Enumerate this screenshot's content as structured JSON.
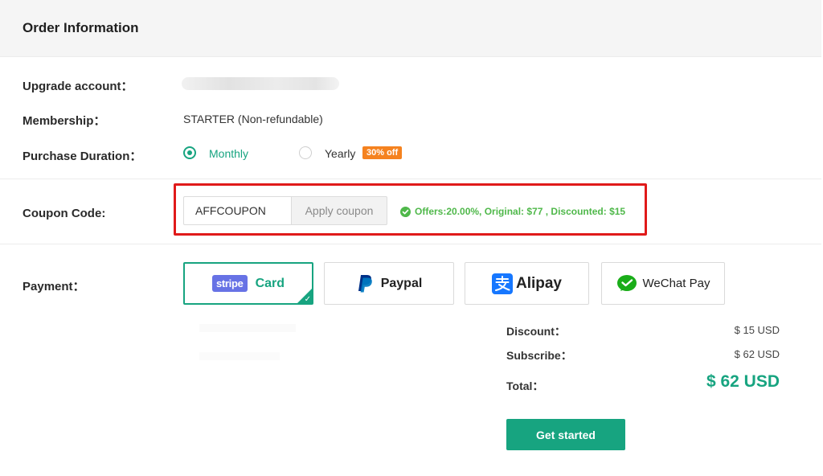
{
  "header": {
    "title": "Order Information"
  },
  "form": {
    "upgrade_account_label": "Upgrade account：",
    "membership_label": "Membership：",
    "membership_value": "STARTER (Non-refundable)",
    "duration_label": "Purchase Duration：",
    "duration_options": [
      {
        "label": "Monthly",
        "checked": true
      },
      {
        "label": "Yearly",
        "checked": false
      }
    ],
    "yearly_badge": "30% off",
    "coupon_label": "Coupon Code:",
    "coupon_value": "AFFCOUPON",
    "apply_label": "Apply coupon",
    "offer_text": "Offers:20.00%, Original: $77 , Discounted: $15",
    "payment_label": "Payment："
  },
  "payment_methods": [
    {
      "name": "stripe",
      "logo_text": "stripe",
      "label": "Card",
      "selected": true
    },
    {
      "name": "paypal",
      "label": "Paypal",
      "selected": false
    },
    {
      "name": "alipay",
      "label": "Alipay",
      "selected": false
    },
    {
      "name": "wechat",
      "label": "WeChat Pay",
      "selected": false
    }
  ],
  "summary": {
    "discount_label": "Discount：",
    "discount_value": "$ 15 USD",
    "subscribe_label": "Subscribe：",
    "subscribe_value": "$ 62 USD",
    "total_label": "Total：",
    "total_value": "$ 62 USD"
  },
  "cta": {
    "label": "Get started"
  },
  "colors": {
    "accent": "#17a480",
    "highlight": "#e01a1a",
    "badge": "#f5821f",
    "offer": "#4fb84a",
    "stripe": "#6772e5"
  }
}
